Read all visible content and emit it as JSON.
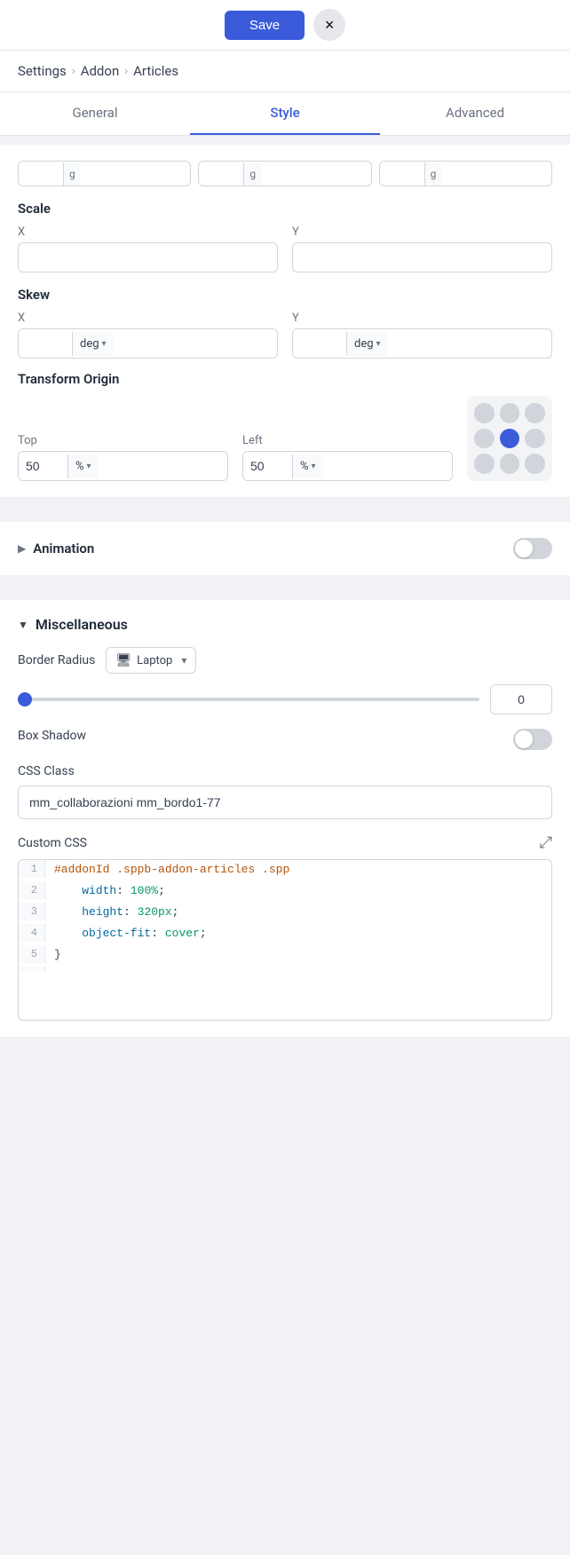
{
  "topBar": {
    "saveLabel": "Save",
    "closeLabel": "×"
  },
  "breadcrumb": {
    "items": [
      "Settings",
      "Addon",
      "Articles"
    ],
    "separators": [
      "›",
      "›"
    ]
  },
  "tabs": [
    {
      "id": "general",
      "label": "General"
    },
    {
      "id": "style",
      "label": "Style",
      "active": true
    },
    {
      "id": "advanced",
      "label": "Advanced"
    }
  ],
  "scale": {
    "label": "Scale",
    "x": {
      "label": "X",
      "value": ""
    },
    "y": {
      "label": "Y",
      "value": ""
    }
  },
  "skew": {
    "label": "Skew",
    "x": {
      "label": "X",
      "value": "",
      "unit": "deg"
    },
    "y": {
      "label": "Y",
      "value": "",
      "unit": "deg"
    }
  },
  "transformOrigin": {
    "label": "Transform Origin",
    "top": {
      "label": "Top",
      "value": "50",
      "unit": "%"
    },
    "left": {
      "label": "Left",
      "value": "50",
      "unit": "%"
    }
  },
  "animation": {
    "label": "Animation",
    "enabled": false
  },
  "miscellaneous": {
    "label": "Miscellaneous",
    "borderRadius": {
      "label": "Border Radius",
      "device": "Laptop",
      "value": "0"
    },
    "boxShadow": {
      "label": "Box Shadow",
      "enabled": false
    },
    "cssClass": {
      "label": "CSS Class",
      "value": "mm_collaborazioni mm_bordo1-77"
    },
    "customCss": {
      "label": "Custom CSS",
      "lines": [
        {
          "num": "1",
          "code": "#addonId .sppb-addon-articles .spp"
        },
        {
          "num": "2",
          "code": "    width: 100%;"
        },
        {
          "num": "3",
          "code": "    height: 320px;"
        },
        {
          "num": "4",
          "code": "    object-fit: cover;"
        },
        {
          "num": "5",
          "code": "}"
        }
      ]
    }
  }
}
